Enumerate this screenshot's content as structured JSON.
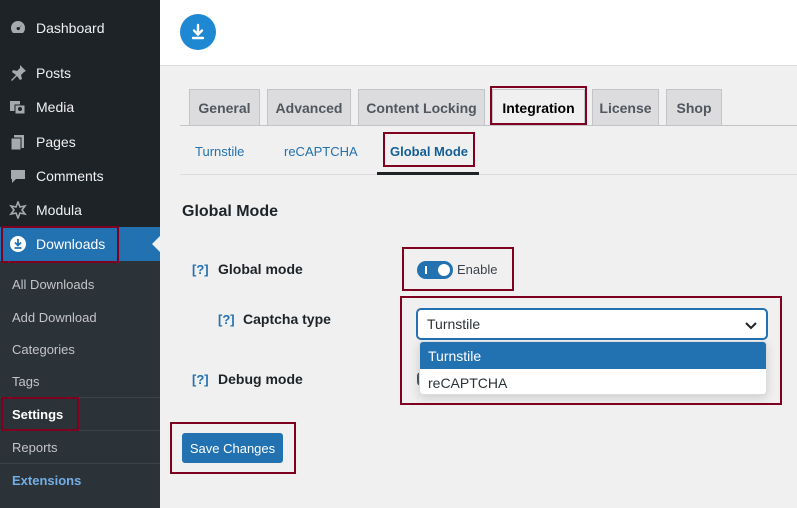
{
  "sidebar": {
    "menu": [
      {
        "label": "Dashboard",
        "icon": "dashboard-icon"
      },
      {
        "label": "Posts",
        "icon": "pin-icon"
      },
      {
        "label": "Media",
        "icon": "media-icon"
      },
      {
        "label": "Pages",
        "icon": "pages-icon"
      },
      {
        "label": "Comments",
        "icon": "comment-icon"
      },
      {
        "label": "Modula",
        "icon": "modula-icon"
      },
      {
        "label": "Downloads",
        "icon": "download-icon"
      }
    ],
    "submenu": [
      "All Downloads",
      "Add Download",
      "Categories",
      "Tags",
      "Settings",
      "Reports",
      "Extensions"
    ]
  },
  "tabs": [
    "General",
    "Advanced",
    "Content Locking",
    "Integration",
    "License",
    "Shop"
  ],
  "subtabs": [
    "Turnstile",
    "reCAPTCHA",
    "Global Mode"
  ],
  "section_title": "Global Mode",
  "fields": {
    "help": "[?]",
    "global_mode": {
      "label": "Global mode",
      "toggle_label": "Enable"
    },
    "captcha_type": {
      "label": "Captcha type",
      "value": "Turnstile",
      "options": [
        "Turnstile",
        "reCAPTCHA"
      ]
    },
    "debug_mode": {
      "label": "Debug mode"
    }
  },
  "save_button": "Save Changes",
  "colors": {
    "accent": "#2271b1",
    "sidebar": "#1d2327",
    "highlight": "#800020"
  }
}
